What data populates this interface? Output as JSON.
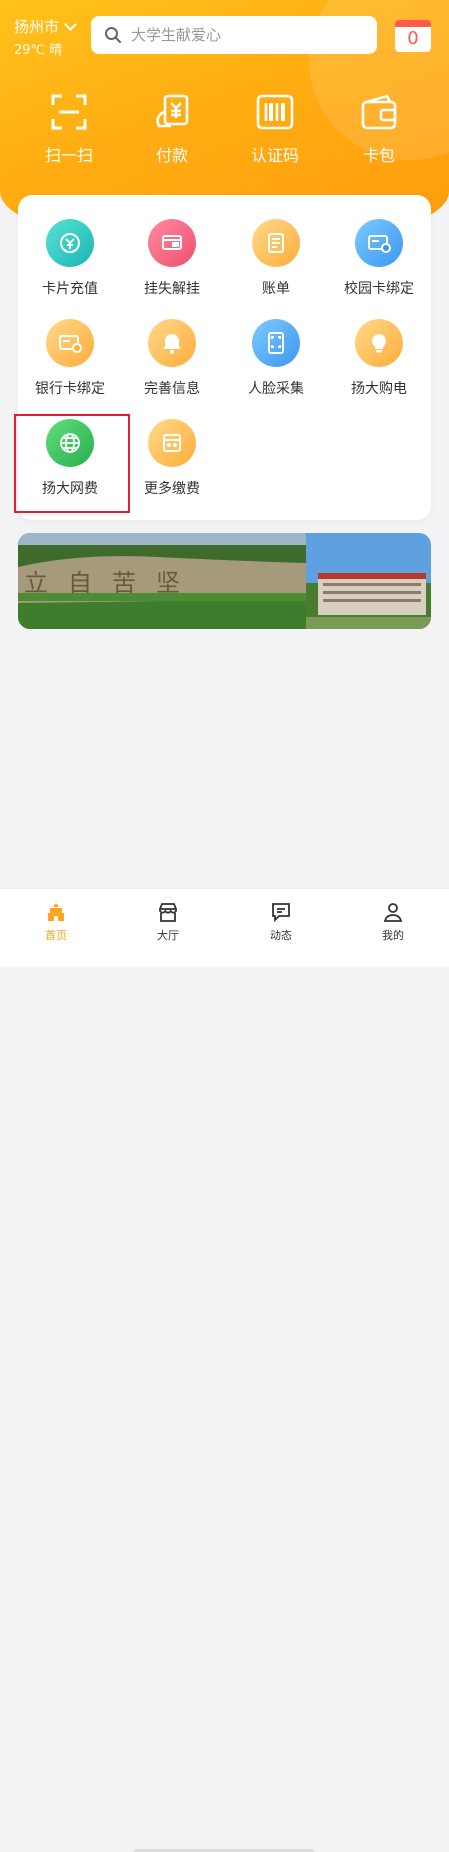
{
  "header": {
    "city": "扬州市",
    "weather": "29℃ 晴",
    "search_placeholder": "大学生献爱心",
    "calendar_count": "0"
  },
  "quick_actions": [
    {
      "label": "扫一扫",
      "icon": "scan-icon"
    },
    {
      "label": "付款",
      "icon": "payment-icon"
    },
    {
      "label": "认证码",
      "icon": "barcode-icon"
    },
    {
      "label": "卡包",
      "icon": "wallet-icon"
    }
  ],
  "services": [
    {
      "label": "卡片充值",
      "icon": "card-recharge-icon",
      "color": "#1ab6b6"
    },
    {
      "label": "挂失解挂",
      "icon": "report-loss-icon",
      "color": "#f0506e"
    },
    {
      "label": "账单",
      "icon": "bill-icon",
      "color": "#ffac3a"
    },
    {
      "label": "校园卡绑定",
      "icon": "campus-card-bind-icon",
      "color": "#3c97f0"
    },
    {
      "label": "银行卡绑定",
      "icon": "bank-card-bind-icon",
      "color": "#ffac3a"
    },
    {
      "label": "完善信息",
      "icon": "bell-icon",
      "color": "#ffac3a"
    },
    {
      "label": "人脸采集",
      "icon": "face-scan-icon",
      "color": "#3c97f0"
    },
    {
      "label": "扬大购电",
      "icon": "lightbulb-icon",
      "color": "#ffac3a"
    },
    {
      "label": "扬大网费",
      "icon": "globe-icon",
      "color": "#25b04c"
    },
    {
      "label": "更多缴费",
      "icon": "calculator-icon",
      "color": "#ffac3a"
    }
  ],
  "banner": {
    "stone_text": "立自苦坚"
  },
  "tabs": [
    {
      "label": "首页",
      "icon": "home-icon",
      "active": true
    },
    {
      "label": "大厅",
      "icon": "store-icon",
      "active": false
    },
    {
      "label": "动态",
      "icon": "message-icon",
      "active": false
    },
    {
      "label": "我的",
      "icon": "user-icon",
      "active": false
    }
  ],
  "colors": {
    "brand_orange": "#ffa41b",
    "highlight_red": "#e0202a"
  }
}
